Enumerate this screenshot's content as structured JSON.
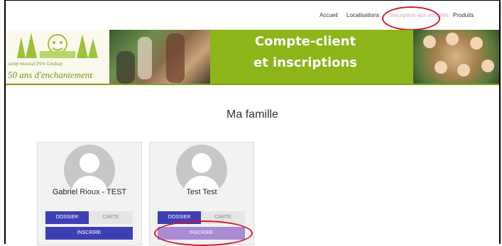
{
  "nav": {
    "items": [
      "Accueil",
      "Localisations",
      "Inscription aux activités",
      "Produits"
    ]
  },
  "banner": {
    "logo_line1": "camp musical Père Lindsay",
    "logo_line2": "50 ans d'enchantement",
    "title_line1": "Compte-client",
    "title_line2": "et inscriptions"
  },
  "main": {
    "heading": "Ma famille",
    "members": [
      {
        "name": "Gabriel Rioux - TEST",
        "dossier": "DOSSIER",
        "carte": "CARTE",
        "inscrire": "INSCRIRE"
      },
      {
        "name": "Test Test",
        "dossier": "DOSSIER",
        "carte": "CARTE",
        "inscrire": "INSCRIRE"
      }
    ]
  },
  "colors": {
    "banner_green": "#8cb519",
    "primary_button": "#3f3fb5",
    "highlight_circle": "#d11a2a"
  }
}
